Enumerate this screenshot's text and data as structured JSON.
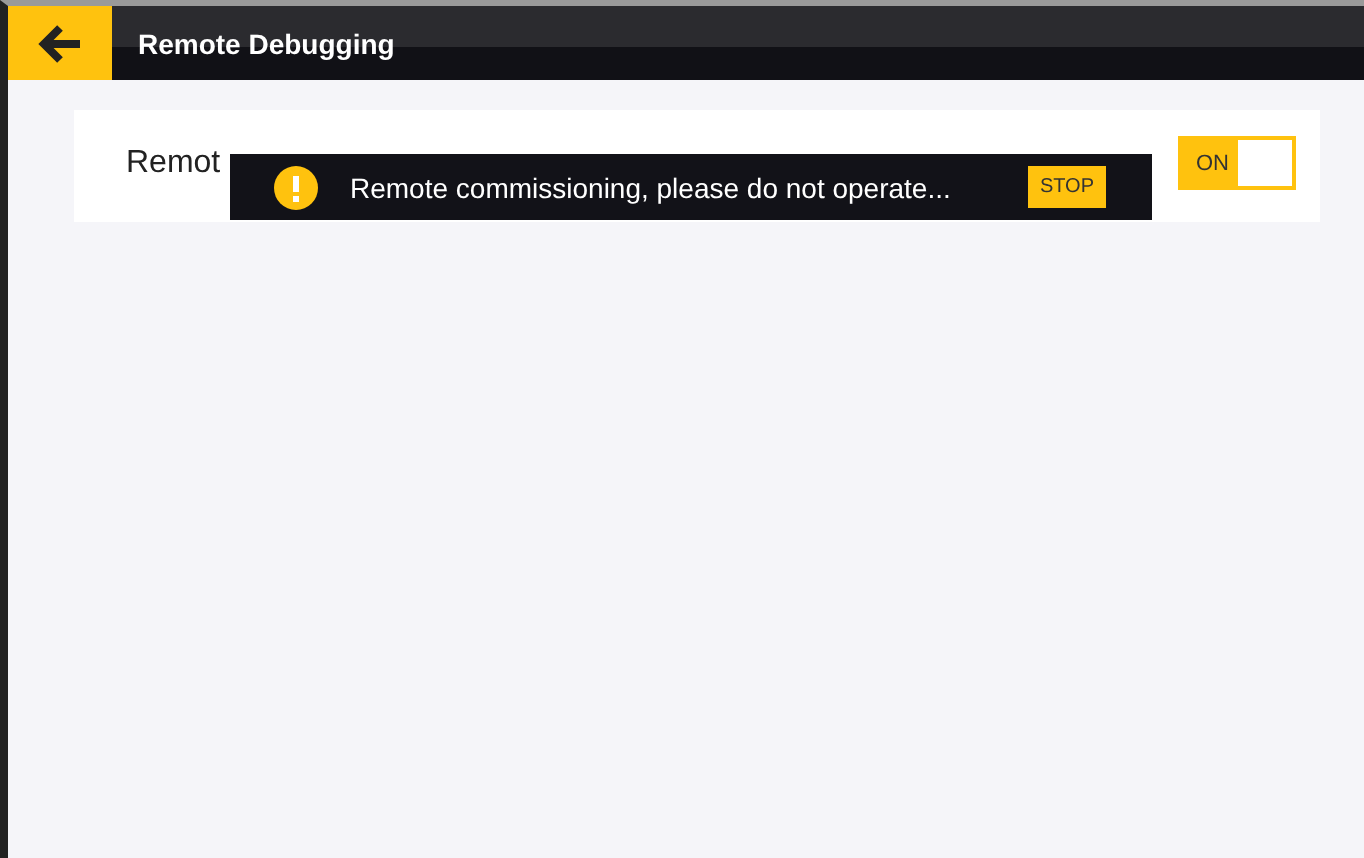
{
  "header": {
    "title": "Remote Debugging"
  },
  "setting": {
    "label": "Remot",
    "toggle": {
      "label": "ON",
      "on": true
    }
  },
  "toast": {
    "message": "Remote commissioning, please do not operate...",
    "button": "STOP"
  }
}
